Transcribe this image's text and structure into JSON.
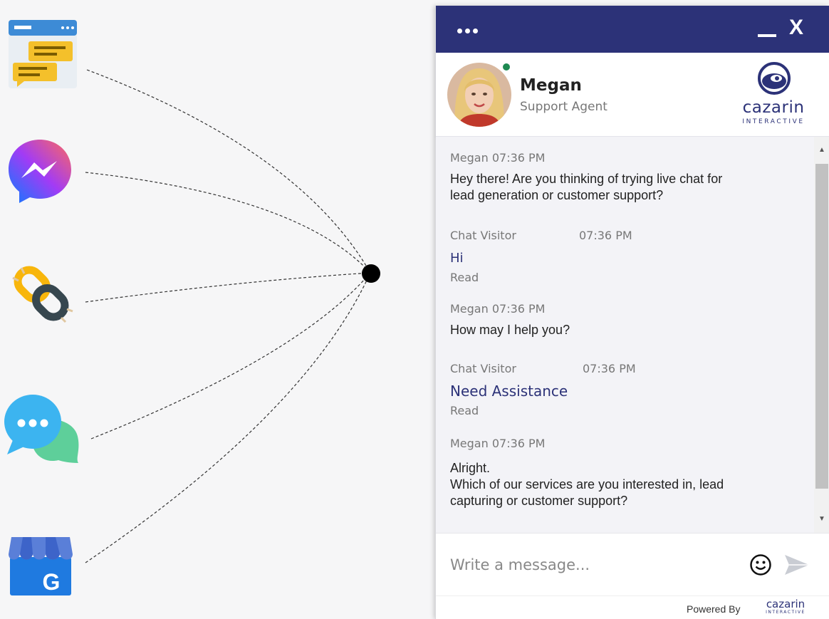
{
  "channels": [
    {
      "name": "website-chat",
      "icon": "website-chat-icon"
    },
    {
      "name": "messenger",
      "icon": "messenger-icon"
    },
    {
      "name": "link",
      "icon": "link-icon"
    },
    {
      "name": "sms-chat",
      "icon": "chat-bubbles-icon"
    },
    {
      "name": "google-business",
      "icon": "google-business-icon"
    }
  ],
  "colors": {
    "header": "#2c3278",
    "online": "#1e8a52",
    "visitor_text": "#2c3278",
    "messages_bg": "#f3f3f7"
  },
  "header": {
    "menu_icon": "more-dots-icon",
    "minimize_icon": "minimize-icon",
    "close_label": "X"
  },
  "agent": {
    "name": "Megan",
    "role": "Support Agent",
    "status": "online"
  },
  "brand": {
    "name": "cazarin",
    "tagline": "INTERACTIVE"
  },
  "messages": [
    {
      "sender": "Megan",
      "time": "07:36 PM",
      "meta": "Megan 07:36 PM",
      "text_lines": [
        "Hey there! Are you thinking of trying live chat for",
        "lead generation or customer support?"
      ]
    },
    {
      "sender": "Chat Visitor",
      "time": "07:36 PM",
      "text": "Hi",
      "status": "Read"
    },
    {
      "sender": "Megan",
      "time": "07:36 PM",
      "meta": "Megan 07:36 PM",
      "text_lines": [
        "How may I help you?"
      ]
    },
    {
      "sender": "Chat Visitor",
      "time": "07:36 PM",
      "text": "Need Assistance",
      "status": "Read"
    },
    {
      "sender": "Megan",
      "time": "07:36 PM",
      "meta": "Megan 07:36 PM",
      "text_lines": [
        "Alright.",
        "Which of our services are you interested in, lead",
        "capturing or customer support?"
      ]
    }
  ],
  "composer": {
    "placeholder": "Write a message...",
    "emoji_icon": "smiley-icon",
    "send_icon": "send-arrow-icon"
  },
  "footer": {
    "powered_by": "Powered By",
    "logo_name": "cazarin",
    "logo_tagline": "INTERACTIVE"
  }
}
